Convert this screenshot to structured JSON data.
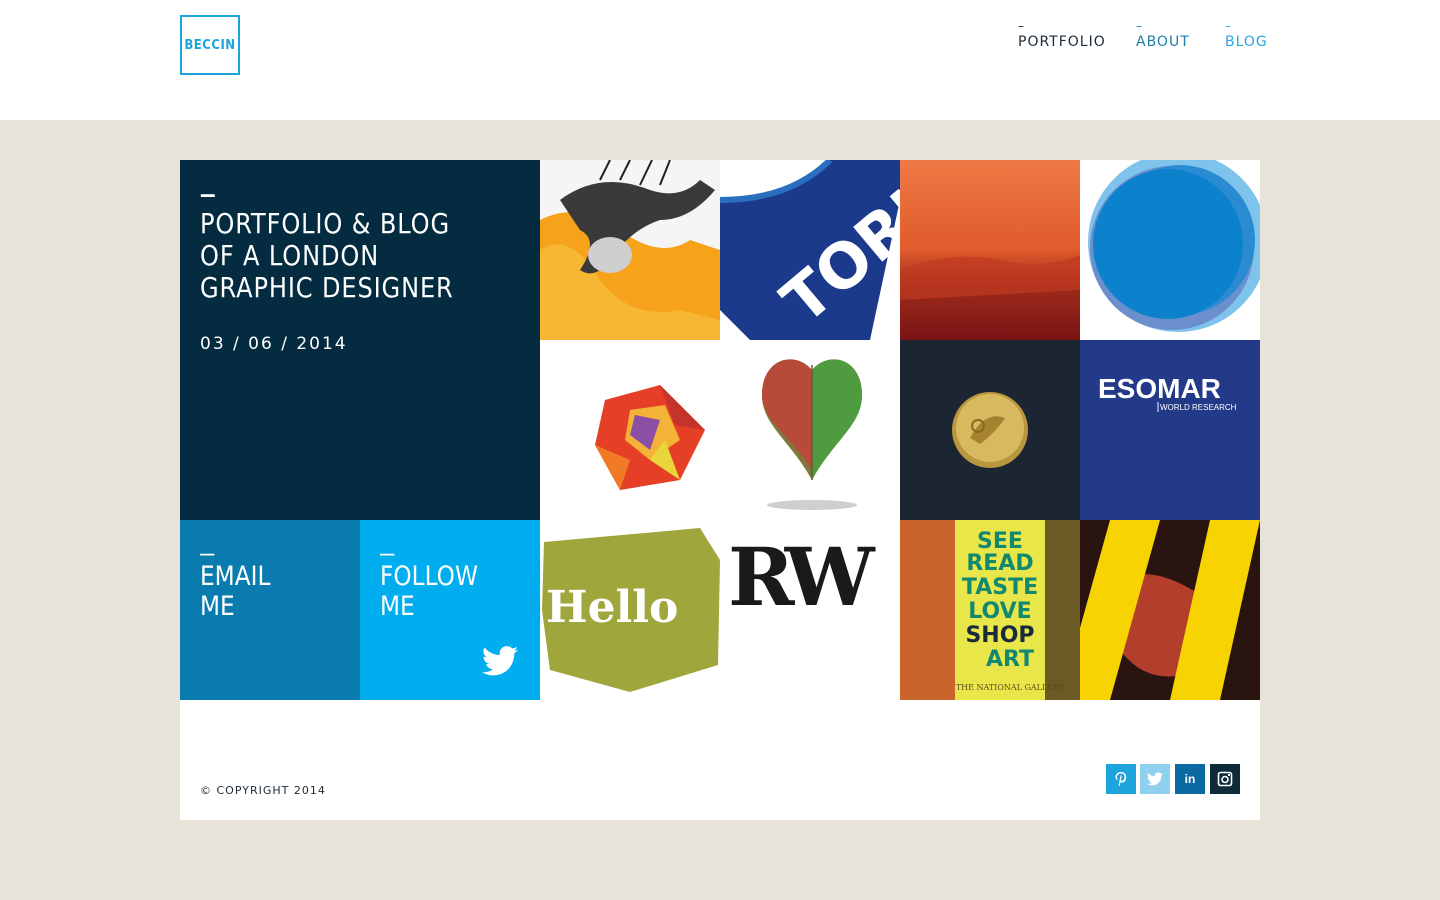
{
  "header": {
    "logo": "BECCIN",
    "nav": [
      {
        "dash": "–",
        "label": "PORTFOLIO"
      },
      {
        "dash": "–",
        "label": "ABOUT"
      },
      {
        "dash": "–",
        "label": "BLOG"
      }
    ]
  },
  "intro": {
    "dash": "–",
    "title_line1": "PORTFOLIO & BLOG",
    "title_line2": "OF A LONDON",
    "title_line3": "GRAPHIC DESIGNER",
    "date": "03 / 06 / 2014"
  },
  "cta": {
    "email": {
      "dash": "–",
      "line1": "EMAIL",
      "line2": "ME"
    },
    "follow": {
      "dash": "–",
      "line1": "FOLLOW",
      "line2": "ME"
    }
  },
  "tiles": {
    "tork_text": "TORK",
    "esomar_text": "ESOMAR",
    "esomar_sub": "WORLD RESEARCH",
    "hello_text": "Hello",
    "rw_text": "RW",
    "poster_lines": [
      "SEE",
      "READ",
      "TASTE",
      "LOVE",
      "SHOP",
      "ART"
    ],
    "poster_small": "THE NATIONAL GALLERY"
  },
  "footer": {
    "copyright": "© COPYRIGHT 2014",
    "social": [
      "pinterest-icon",
      "twitter-icon",
      "linkedin-icon",
      "instagram-icon"
    ],
    "linkedin_text": "in"
  },
  "colors": {
    "accent": "#1ea4dd",
    "intro_bg": "#042b3f",
    "email_bg": "#0a7bae",
    "follow_bg": "#00adef",
    "page_bg": "#e8e3d9"
  }
}
